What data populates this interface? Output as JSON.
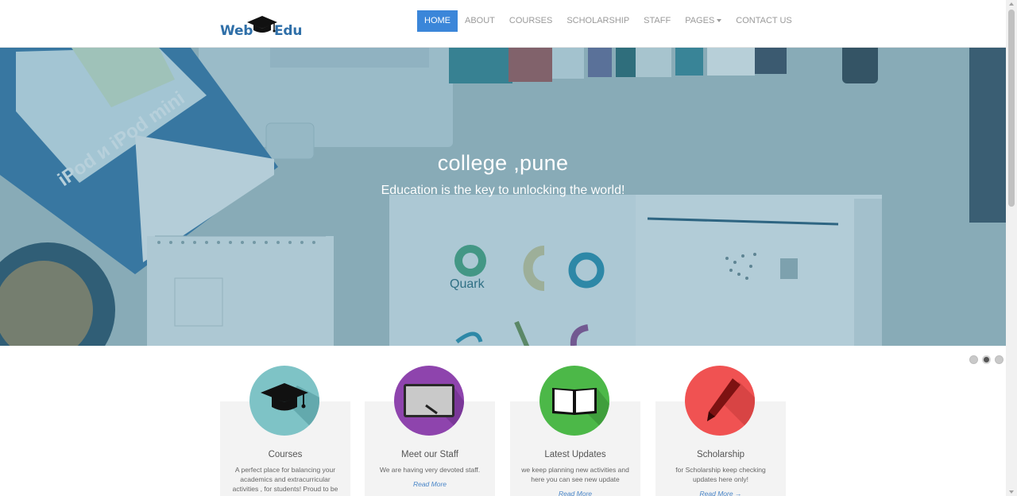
{
  "logo": {
    "left": "Web",
    "right": "Edu"
  },
  "nav": {
    "items": [
      {
        "label": "HOME",
        "active": true
      },
      {
        "label": "ABOUT"
      },
      {
        "label": "COURSES"
      },
      {
        "label": "SCHOLARSHIP"
      },
      {
        "label": "STAFF"
      },
      {
        "label": "PAGES",
        "dropdown": true
      },
      {
        "label": "CONTACT US"
      }
    ]
  },
  "hero": {
    "title": "college ,pune",
    "subtitle": "Education is the key to unlocking the world!",
    "slides": 3,
    "active_slide": 2
  },
  "features": [
    {
      "title": "Courses",
      "description": "A perfect place for balancing your academics and extracurricular activities , for students! Proud to be",
      "link": "",
      "icon": "graduation-cap-icon",
      "color": "#7ec3c6"
    },
    {
      "title": "Meet our Staff",
      "description": "We are having very devoted staff.",
      "link": "Read More",
      "icon": "tablet-pen-icon",
      "color": "#8e44ad"
    },
    {
      "title": "Latest Updates",
      "description": "we keep planning new activities and here you can see new update",
      "link": "Read More",
      "icon": "open-book-icon",
      "color": "#4cb848"
    },
    {
      "title": "Scholarship",
      "description": "for Scholarship keep checking updates here only!",
      "link": "Read More →",
      "icon": "pen-icon",
      "color": "#f05252"
    }
  ]
}
